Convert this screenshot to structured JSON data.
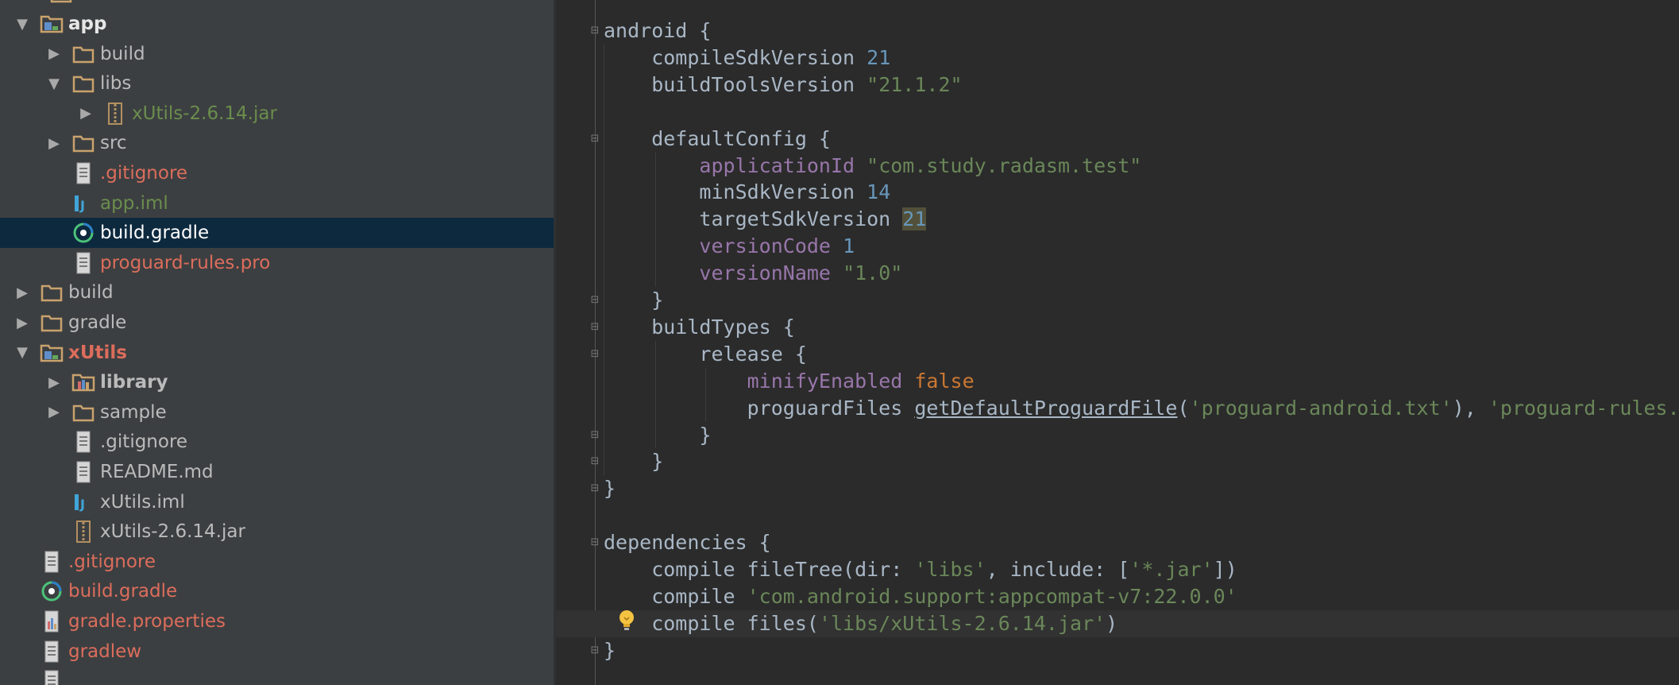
{
  "tree": {
    "items": [
      {
        "label": "app",
        "depth": 1,
        "expand": "open",
        "icon": "module-folder",
        "style": "bold white"
      },
      {
        "label": "build",
        "depth": 2,
        "expand": "closed",
        "icon": "folder",
        "style": ""
      },
      {
        "label": "libs",
        "depth": 2,
        "expand": "open",
        "icon": "folder",
        "style": ""
      },
      {
        "label": "xUtils-2.6.14.jar",
        "depth": 3,
        "expand": "closed",
        "icon": "jar",
        "style": "green"
      },
      {
        "label": "src",
        "depth": 2,
        "expand": "closed",
        "icon": "folder",
        "style": ""
      },
      {
        "label": ".gitignore",
        "depth": 2,
        "expand": "none",
        "icon": "text-file",
        "style": "red"
      },
      {
        "label": "app.iml",
        "depth": 2,
        "expand": "none",
        "icon": "iml",
        "style": "green"
      },
      {
        "label": "build.gradle",
        "depth": 2,
        "expand": "none",
        "icon": "gradle",
        "style": "selected"
      },
      {
        "label": "proguard-rules.pro",
        "depth": 2,
        "expand": "none",
        "icon": "text-file",
        "style": "red"
      },
      {
        "label": "build",
        "depth": 1,
        "expand": "closed",
        "icon": "folder",
        "style": ""
      },
      {
        "label": "gradle",
        "depth": 1,
        "expand": "closed",
        "icon": "folder",
        "style": ""
      },
      {
        "label": "xUtils",
        "depth": 1,
        "expand": "open",
        "icon": "module-folder",
        "style": "bold red"
      },
      {
        "label": "library",
        "depth": 2,
        "expand": "closed",
        "icon": "library-folder",
        "style": "bold"
      },
      {
        "label": "sample",
        "depth": 2,
        "expand": "closed",
        "icon": "folder",
        "style": ""
      },
      {
        "label": ".gitignore",
        "depth": 2,
        "expand": "none",
        "icon": "text-file",
        "style": ""
      },
      {
        "label": "README.md",
        "depth": 2,
        "expand": "none",
        "icon": "text-file",
        "style": ""
      },
      {
        "label": "xUtils.iml",
        "depth": 2,
        "expand": "none",
        "icon": "iml",
        "style": ""
      },
      {
        "label": "xUtils-2.6.14.jar",
        "depth": 2,
        "expand": "none",
        "icon": "jar",
        "style": ""
      },
      {
        "label": ".gitignore",
        "depth": 1,
        "expand": "none",
        "icon": "text-file",
        "style": "red"
      },
      {
        "label": "build.gradle",
        "depth": 1,
        "expand": "none",
        "icon": "gradle",
        "style": "red"
      },
      {
        "label": "gradle.properties",
        "depth": 1,
        "expand": "none",
        "icon": "properties",
        "style": "red"
      },
      {
        "label": "gradlew",
        "depth": 1,
        "expand": "none",
        "icon": "text-file",
        "style": "red"
      }
    ]
  },
  "editor": {
    "lines": [
      [
        [
          "android {",
          ""
        ]
      ],
      [
        [
          "    compileSdkVersion ",
          ""
        ],
        [
          "21",
          "num"
        ]
      ],
      [
        [
          "    buildToolsVersion ",
          ""
        ],
        [
          "\"21.1.2\"",
          "str"
        ]
      ],
      [
        [
          "",
          ""
        ]
      ],
      [
        [
          "    defaultConfig {",
          ""
        ]
      ],
      [
        [
          "        ",
          ""
        ],
        [
          "applicationId",
          "prop"
        ],
        [
          " ",
          ""
        ],
        [
          "\"com.study.radasm.test\"",
          "str"
        ]
      ],
      [
        [
          "        minSdkVersion ",
          ""
        ],
        [
          "14",
          "num"
        ]
      ],
      [
        [
          "        targetSdkVersion ",
          ""
        ],
        [
          "21",
          "num hl"
        ]
      ],
      [
        [
          "        ",
          ""
        ],
        [
          "versionCode",
          "prop"
        ],
        [
          " ",
          ""
        ],
        [
          "1",
          "num"
        ]
      ],
      [
        [
          "        ",
          ""
        ],
        [
          "versionName",
          "prop"
        ],
        [
          " ",
          ""
        ],
        [
          "\"1.0\"",
          "str"
        ]
      ],
      [
        [
          "    }",
          ""
        ]
      ],
      [
        [
          "    buildTypes {",
          ""
        ]
      ],
      [
        [
          "        release {",
          ""
        ]
      ],
      [
        [
          "            ",
          ""
        ],
        [
          "minifyEnabled",
          "prop"
        ],
        [
          " ",
          ""
        ],
        [
          "false",
          "kw"
        ]
      ],
      [
        [
          "            proguardFiles ",
          ""
        ],
        [
          "getDefaultProguardFile",
          "ul"
        ],
        [
          "(",
          ""
        ],
        [
          "'proguard-android.txt'",
          "str"
        ],
        [
          "), ",
          ""
        ],
        [
          "'proguard-rules.pro'",
          "str"
        ]
      ],
      [
        [
          "        }",
          ""
        ]
      ],
      [
        [
          "    }",
          ""
        ]
      ],
      [
        [
          "}",
          ""
        ]
      ],
      [
        [
          "",
          ""
        ]
      ],
      [
        [
          "dependencies {",
          ""
        ]
      ],
      [
        [
          "    compile fileTree(dir: ",
          ""
        ],
        [
          "'libs'",
          "str"
        ],
        [
          ", include: [",
          ""
        ],
        [
          "'*.jar'",
          "str"
        ],
        [
          "])",
          ""
        ]
      ],
      [
        [
          "    compile ",
          ""
        ],
        [
          "'com.android.support:appcompat-v7:22.0.0'",
          "str"
        ]
      ],
      [
        [
          "    compile files(",
          ""
        ],
        [
          "'libs/xUtils-2.6.14.jar'",
          "str"
        ],
        [
          ")",
          ""
        ]
      ],
      [
        [
          "}",
          ""
        ]
      ]
    ],
    "current_line": 22,
    "fold_markers": [
      {
        "line": 0,
        "type": "open"
      },
      {
        "line": 4,
        "type": "open"
      },
      {
        "line": 10,
        "type": "close"
      },
      {
        "line": 11,
        "type": "open"
      },
      {
        "line": 12,
        "type": "open"
      },
      {
        "line": 15,
        "type": "close"
      },
      {
        "line": 16,
        "type": "close"
      },
      {
        "line": 17,
        "type": "close"
      },
      {
        "line": 19,
        "type": "open"
      },
      {
        "line": 23,
        "type": "close"
      }
    ]
  },
  "colors": {
    "tree_bg": "#3c3f41",
    "selection": "#0d293e",
    "folder": "#c9a26d",
    "editor_bg": "#2b2b2b",
    "vcs_modified_red": "#dc6d5c",
    "vcs_added_green": "#6a8d4d"
  }
}
